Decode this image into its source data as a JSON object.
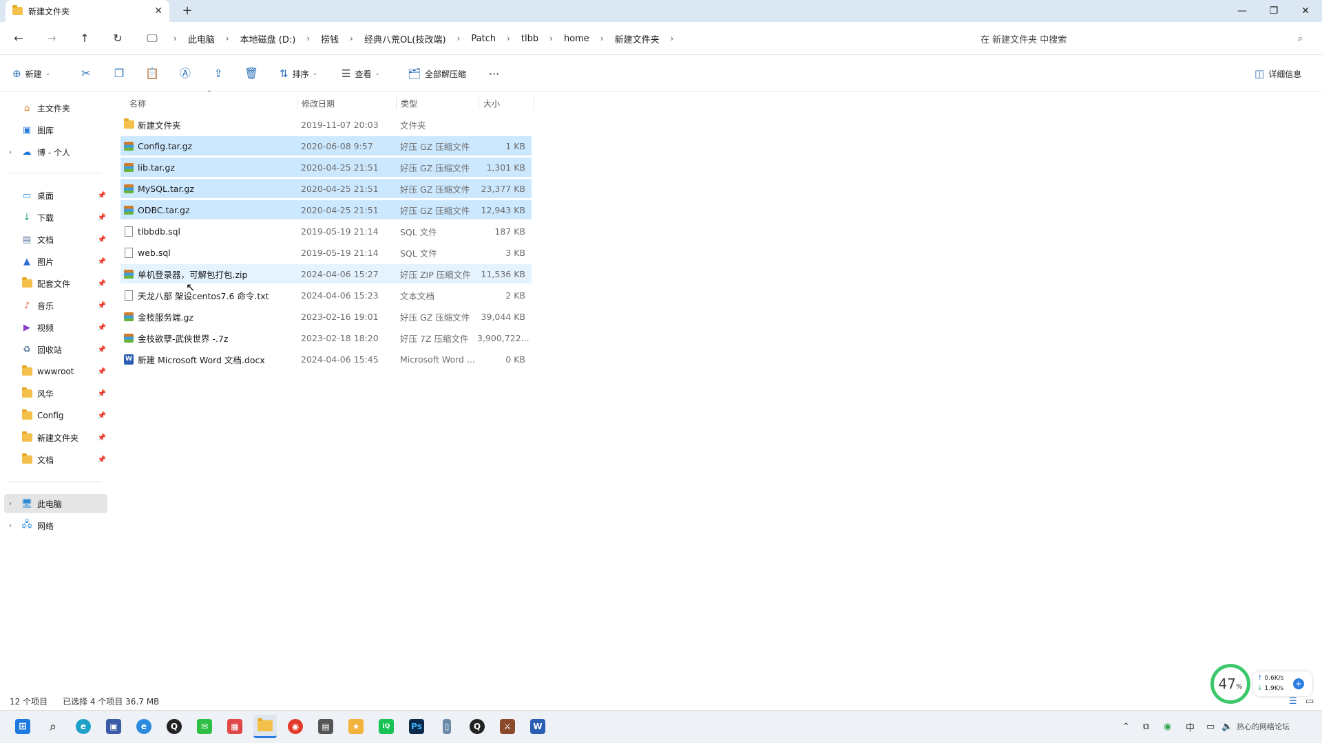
{
  "window": {
    "tab_title": "新建文件夹",
    "new_tab": "+",
    "minimize": "—",
    "maximize": "❐",
    "close": "✕"
  },
  "nav": {
    "back": "←",
    "forward": "→",
    "up": "↑",
    "refresh": "↻",
    "breadcrumbs": [
      "此电脑",
      "本地磁盘 (D:)",
      "捞钱",
      "经典八荒OL(技改端)",
      "Patch",
      "tlbb",
      "home",
      "新建文件夹"
    ],
    "search_placeholder": "在 新建文件夹 中搜索"
  },
  "commands": {
    "new": "新建",
    "sort": "排序",
    "view": "查看",
    "extract_all": "全部解压缩",
    "more": "···",
    "details": "详细信息"
  },
  "sidebar": {
    "top": [
      {
        "label": "主文件夹",
        "icon": "home-icon"
      },
      {
        "label": "图库",
        "icon": "gallery-icon"
      },
      {
        "label": "博 - 个人",
        "icon": "cloud-icon"
      }
    ],
    "pinned": [
      {
        "label": "桌面",
        "icon": "desktop-icon"
      },
      {
        "label": "下载",
        "icon": "download-icon"
      },
      {
        "label": "文档",
        "icon": "documents-icon"
      },
      {
        "label": "图片",
        "icon": "pictures-icon"
      },
      {
        "label": "配套文件",
        "icon": "folder-icon"
      },
      {
        "label": "音乐",
        "icon": "music-icon"
      },
      {
        "label": "视频",
        "icon": "video-icon"
      },
      {
        "label": "回收站",
        "icon": "recycle-bin-icon"
      },
      {
        "label": "wwwroot",
        "icon": "folder-icon"
      },
      {
        "label": "风华",
        "icon": "folder-icon"
      },
      {
        "label": "Config",
        "icon": "folder-icon"
      },
      {
        "label": "新建文件夹",
        "icon": "folder-icon"
      },
      {
        "label": "文档",
        "icon": "folder-icon"
      }
    ],
    "bottom": [
      {
        "label": "此电脑",
        "icon": "this-pc-icon"
      },
      {
        "label": "网络",
        "icon": "network-icon"
      }
    ]
  },
  "columns": {
    "name": "名称",
    "date": "修改日期",
    "type": "类型",
    "size": "大小"
  },
  "files": [
    {
      "name": "新建文件夹",
      "date": "2019-11-07 20:03",
      "type": "文件夹",
      "size": "",
      "icon": "folder-icon",
      "selected": false
    },
    {
      "name": "Config.tar.gz",
      "date": "2020-06-08 9:57",
      "type": "好压 GZ 压缩文件",
      "size": "1 KB",
      "icon": "archive-icon",
      "selected": true
    },
    {
      "name": "lib.tar.gz",
      "date": "2020-04-25 21:51",
      "type": "好压 GZ 压缩文件",
      "size": "1,301 KB",
      "icon": "archive-icon",
      "selected": true
    },
    {
      "name": "MySQL.tar.gz",
      "date": "2020-04-25 21:51",
      "type": "好压 GZ 压缩文件",
      "size": "23,377 KB",
      "icon": "archive-icon",
      "selected": true
    },
    {
      "name": "ODBC.tar.gz",
      "date": "2020-04-25 21:51",
      "type": "好压 GZ 压缩文件",
      "size": "12,943 KB",
      "icon": "archive-icon",
      "selected": true
    },
    {
      "name": "tlbbdb.sql",
      "date": "2019-05-19 21:14",
      "type": "SQL 文件",
      "size": "187 KB",
      "icon": "file-icon",
      "selected": false
    },
    {
      "name": "web.sql",
      "date": "2019-05-19 21:14",
      "type": "SQL 文件",
      "size": "3 KB",
      "icon": "file-icon",
      "selected": false
    },
    {
      "name": "单机登录器，可解包打包.zip",
      "date": "2024-04-06 15:27",
      "type": "好压 ZIP 压缩文件",
      "size": "11,536 KB",
      "icon": "archive-icon",
      "selected": false
    },
    {
      "name": "天龙八部 架设centos7.6 命令.txt",
      "date": "2024-04-06 15:23",
      "type": "文本文档",
      "size": "2 KB",
      "icon": "text-file-icon",
      "selected": false
    },
    {
      "name": "金枝服务端.gz",
      "date": "2023-02-16 19:01",
      "type": "好压 GZ 压缩文件",
      "size": "39,044 KB",
      "icon": "archive-icon",
      "selected": false
    },
    {
      "name": "金枝欲孽-武侠世界 -.7z",
      "date": "2023-02-18 18:20",
      "type": "好压 7Z 压缩文件",
      "size": "3,900,722...",
      "icon": "archive-icon",
      "selected": false
    },
    {
      "name": "新建 Microsoft Word 文档.docx",
      "date": "2024-04-06 15:45",
      "type": "Microsoft Word ...",
      "size": "0 KB",
      "icon": "word-icon",
      "selected": false
    }
  ],
  "status": {
    "count": "12 个项目",
    "selection": "已选择 4 个项目  36.7 MB"
  },
  "widget": {
    "percent": "47",
    "percent_unit": "%",
    "up_speed": "0.6K/s",
    "down_speed": "1.9K/s"
  },
  "taskbar": {
    "ime": "中",
    "watermark": "热心的网络论坛"
  }
}
